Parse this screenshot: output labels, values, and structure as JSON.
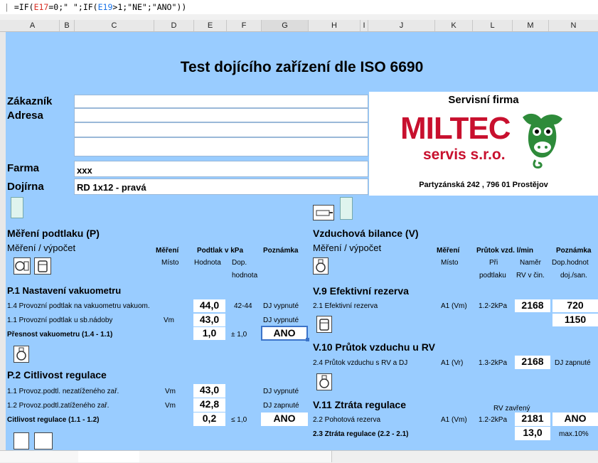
{
  "formula": {
    "prefix": "=IF(",
    "ref1": "E17",
    "part2": "=0;\" \";IF(",
    "ref2": "E19",
    "part3": ">1;\"NE\";\"ANO\"))"
  },
  "columns": [
    "A",
    "B",
    "C",
    "D",
    "E",
    "F",
    "G",
    "H",
    "I",
    "J",
    "K",
    "L",
    "M",
    "N"
  ],
  "title": "Test dojícího zařízení dle ISO 6690",
  "customer": {
    "customer_label": "Zákazník",
    "address_label": "Adresa",
    "farm_label": "Farma",
    "farm_value": "xxx",
    "parlor_label": "Dojírna",
    "parlor_value": "RD 1x12 - pravá"
  },
  "service": {
    "heading": "Servisní firma",
    "logo_main": "MILTEC",
    "logo_sub": "servis s.r.o.",
    "address": "Partyzánská 242 , 796 01 Prostějov"
  },
  "left": {
    "title": "Měření podtlaku (P)",
    "subtitle": "Měření / výpočet",
    "hdr_mereni": "Měření",
    "hdr_misto": "Místo",
    "hdr_podtlak": "Podtlak v kPa",
    "hdr_hodnota": "Hodnota",
    "hdr_dop": "Dop.",
    "hdr_dop2": "hodnota",
    "hdr_poznamka": "Poznámka",
    "p1_title": "P.1 Nastavení vakuometru",
    "p1_row1_label": "1.4 Provozní podtlak na vakuometru vakuom.",
    "p1_row1_value": "44,0",
    "p1_row1_dop": "42-44",
    "p1_row1_note": "DJ vypnuté",
    "p1_row2_label": "1.1 Provozní podtlak u sb.nádoby",
    "p1_row2_misto": "Vm",
    "p1_row2_value": "43,0",
    "p1_row2_note": "DJ vypnuté",
    "p1_row3_label": "Přesnost vakuometru (1.4 - 1.1)",
    "p1_row3_value": "1,0",
    "p1_row3_dop": "± 1,0",
    "p1_row3_result": "ANO",
    "p2_title": "P.2 Citlivost regulace",
    "p2_row1_label": "1.1 Provoz.podtl. nezatíženého zař.",
    "p2_row1_misto": "Vm",
    "p2_row1_value": "43,0",
    "p2_row1_note": "DJ vypnuté",
    "p2_row2_label": "1.2 Provoz.podtl.zatíženého zař.",
    "p2_row2_misto": "Vm",
    "p2_row2_value": "42,8",
    "p2_row2_note": "DJ zapnuté",
    "p2_row3_label": "Citlivost regulace (1.1 - 1.2)",
    "p2_row3_value": "0,2",
    "p2_row3_dop": "≤ 1,0",
    "p2_row3_result": "ANO"
  },
  "right": {
    "title": "Vzduchová bilance (V)",
    "subtitle": "Měření / výpočet",
    "hdr_mereni": "Měření",
    "hdr_misto": "Místo",
    "hdr_prutok": "Průtok vzd. l/min",
    "hdr_pri": "Při",
    "hdr_podtlaku": "podtlaku",
    "hdr_namer": "Naměr",
    "hdr_rv": "RV v čin.",
    "hdr_poznamka": "Poznámka",
    "hdr_dophod": "Dop.hodnot",
    "hdr_doj": "doj./san.",
    "v9_title": "V.9 Efektivní rezerva",
    "v9_row1_label": "2.1 Efektivní rezerva",
    "v9_row1_misto": "A1 (Vm)",
    "v9_row1_pri": "1.2-2kPa",
    "v9_row1_value": "2168",
    "v9_row1_note": "720",
    "v9_row2_note": "1150",
    "v10_title": "V.10 Průtok vzduchu u RV",
    "v10_row1_label": "2.4 Průtok vzduchu s RV a DJ",
    "v10_row1_misto": "A1 (Vr)",
    "v10_row1_pri": "1.3-2kPa",
    "v10_row1_value": "2168",
    "v10_row1_note": "DJ zapnuté",
    "v11_title": "V.11 Ztráta regulace",
    "v11_rv": "RV zavřený",
    "v11_row1_label": "2.2 Pohotová rezerva",
    "v11_row1_misto": "A1 (Vm)",
    "v11_row1_pri": "1.2-2kPa",
    "v11_row1_value": "2181",
    "v11_row1_result": "ANO",
    "v11_row2_label": "2.3 Ztráta regulace (2.2 - 2.1)",
    "v11_row2_value": "13,0",
    "v11_row2_note": "max.10%"
  },
  "colors": {
    "sheet_bg": "#99ccff",
    "logo_red": "#c8102e",
    "logo_green": "#2e8b3a",
    "ref1": "#d93025",
    "ref2": "#1a73e8"
  }
}
